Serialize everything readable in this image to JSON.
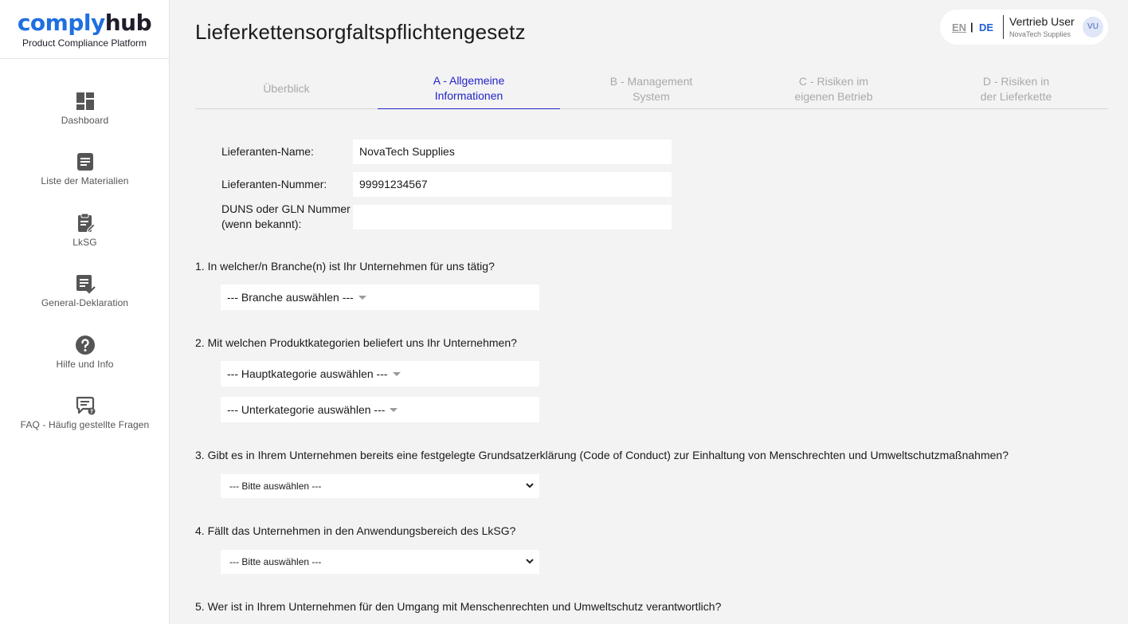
{
  "brand": {
    "logo_part1": "comply",
    "logo_part2": "hub",
    "tagline": "Product Compliance Platform"
  },
  "sidebar": {
    "items": [
      {
        "label": "Dashboard",
        "icon": "dashboard-icon"
      },
      {
        "label": "Liste der Materialien",
        "icon": "document-list-icon"
      },
      {
        "label": "LkSG",
        "icon": "clipboard-edit-icon"
      },
      {
        "label": "General-Deklaration",
        "icon": "declaration-check-icon"
      },
      {
        "label": "Hilfe und Info",
        "icon": "help-circle-icon"
      },
      {
        "label": "FAQ - Häufig gestellte Fragen",
        "icon": "faq-chat-icon"
      }
    ]
  },
  "header": {
    "title": "Lieferkettensorgfaltspflichtengesetz",
    "lang_en": "EN",
    "lang_sep": "|",
    "lang_de": "DE",
    "user_name": "Vertrieb User",
    "user_company": "NovaTech Supplies",
    "avatar_initials": "VU"
  },
  "tabs": [
    {
      "line1": "Überblick",
      "line2": ""
    },
    {
      "line1": "A - Allgemeine",
      "line2": "Informationen"
    },
    {
      "line1": "B - Management",
      "line2": "System"
    },
    {
      "line1": "C - Risiken im",
      "line2": "eigenen Betrieb"
    },
    {
      "line1": "D - Risiken in",
      "line2": "der Lieferkette"
    }
  ],
  "active_tab": "A - Allgemeine Informationen",
  "form": {
    "supplier_name_label": "Lieferanten-Name:",
    "supplier_name_value": "NovaTech Supplies",
    "supplier_number_label": "Lieferanten-Nummer:",
    "supplier_number_value": "99991234567",
    "duns_label_line1": "DUNS oder GLN Nummer",
    "duns_label_line2": "(wenn bekannt):",
    "duns_value": ""
  },
  "questions": [
    {
      "text": "1.  In welcher/n Branche(n) ist Ihr Unternehmen für uns tätig?"
    },
    {
      "text": "2. Mit welchen Produktkategorien beliefert uns Ihr Unternehmen?"
    },
    {
      "text": "3. Gibt es in Ihrem Unternehmen bereits eine festgelegte Grundsatzerklärung (Code of Conduct) zur Einhaltung von Menschrechten und Umweltschutzmaßnahmen?"
    },
    {
      "text": "4. Fällt das Unternehmen in den Anwendungsbereich des LkSG?"
    },
    {
      "text": "5.  Wer ist in Ihrem Unternehmen für den Umgang mit Menschenrechten und Umweltschutz verantwortlich?"
    }
  ],
  "selects": {
    "branche": "--- Branche auswählen ---",
    "hauptkategorie": "--- Hauptkategorie auswählen ---",
    "unterkategorie": "--- Unterkategorie auswählen ---",
    "q3": "--- Bitte auswählen ---",
    "q4": "--- Bitte auswählen ---"
  },
  "colors": {
    "brand_blue": "#1f6fe0",
    "active_tab": "#2323c8",
    "background": "#f3f3f3"
  }
}
